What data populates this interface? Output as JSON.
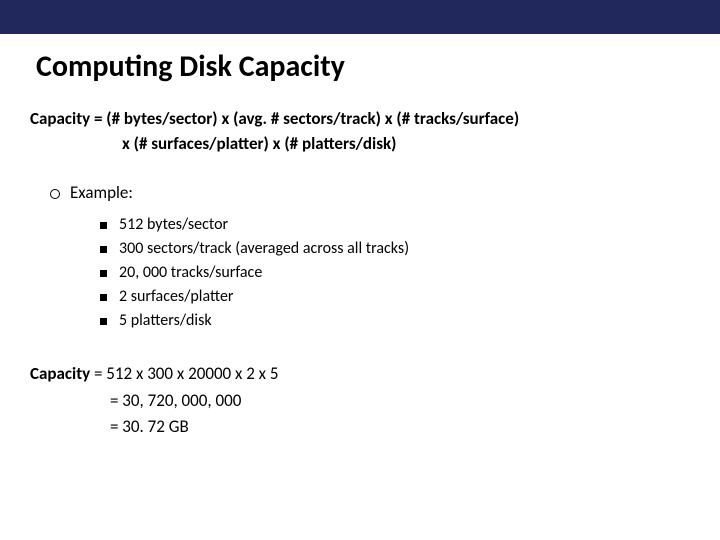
{
  "title": "Computing Disk Capacity",
  "formula": {
    "line1": "Capacity = (# bytes/sector) x (avg. # sectors/track) x (# tracks/surface)",
    "line2": "x (# surfaces/platter) x (# platters/disk)"
  },
  "example": {
    "header": "Example:",
    "items": [
      "512 bytes/sector",
      "300 sectors/track (averaged across all tracks)",
      "20, 000 tracks/surface",
      "2 surfaces/platter",
      "5 platters/disk"
    ]
  },
  "calc": {
    "label": "Capacity",
    "line1": "  = 512 x 300 x 20000 x 2 x 5",
    "line2": "= 30, 720, 000, 000",
    "line3": "= 30. 72 GB"
  }
}
